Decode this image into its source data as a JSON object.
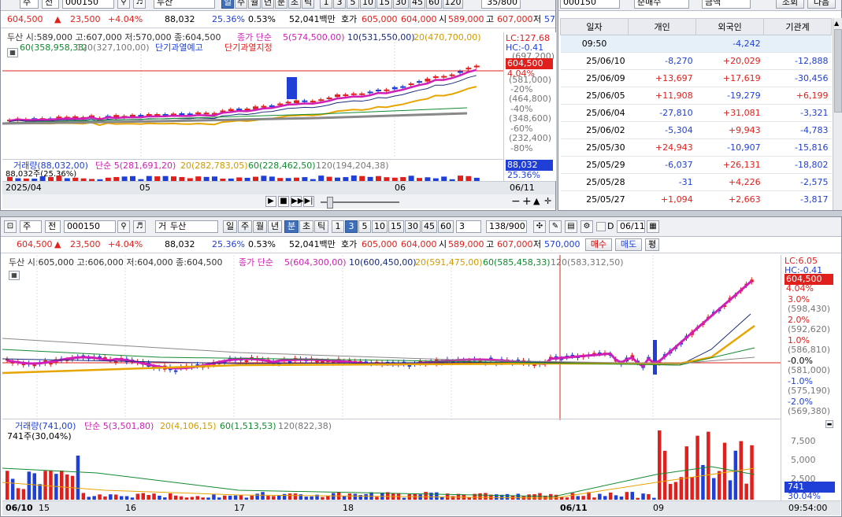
{
  "top_chart": {
    "toolbar": {
      "mode": "주",
      "prefix": "전",
      "code": "000150",
      "name": "두산",
      "period_buttons": [
        "일",
        "주",
        "월",
        "년",
        "분",
        "초",
        "틱"
      ],
      "active_period": "일",
      "minute_buttons": [
        "1",
        "3",
        "5",
        "10",
        "15",
        "30",
        "45",
        "60",
        "120"
      ],
      "count_value": "35/800"
    },
    "info": {
      "price": "604,500",
      "arrow": "▲",
      "change": "23,500",
      "change_pct": "+4.04%",
      "volume": "88,032",
      "turnover_pct": "25.36%",
      "pct2": "0.53%",
      "amount": "52,041백만",
      "bid_label": "호가",
      "ask": "605,000",
      "bid": "604,000",
      "open_label": "시",
      "open": "589,000",
      "high_label": "고",
      "high": "607,000",
      "low_label": "저",
      "low": "57"
    },
    "legend_line1": {
      "ohlc": "두산 시:589,000 고:607,000 저:570,000 종:604,500",
      "ma_label": "종가 단순",
      "ma5": "5(574,500,00)",
      "ma10": "10(531,550,00)",
      "ma20": "20(470,700,00)",
      "ma60": "60(358,958,33)",
      "ma120": "120(327,100,00)",
      "warn1": "단기과열예고",
      "warn2": "단기과열지정"
    },
    "right_axis": {
      "lc": "LC:127.68",
      "hc": "HC:-0.41",
      "top_price": "(697,200)",
      "current_price": "604,500",
      "current_pct": "4.04%",
      "ticks": [
        "(581,000)",
        "-20%",
        "(464,800)",
        "-40%",
        "(348,600)",
        "-60%",
        "(232,400)",
        "-80%"
      ]
    },
    "volume_legend": {
      "label": "거래량(88,032,00)",
      "ma5": "단순 5(281,691,20)",
      "ma20": "20(282,783,05)",
      "ma60": "60(228,462,50)",
      "ma120": "120(194,204,38)",
      "current": "88,032주(25.36%)"
    },
    "volume_axis": {
      "current": "88,032",
      "pct": "25.36%"
    },
    "x_labels": [
      "2025/04",
      "05",
      "06"
    ],
    "x_end": "06/11"
  },
  "investor_table": {
    "toolbar": {
      "code": "000150",
      "sell_buy": "순매수",
      "amount": "금액",
      "search": "조회",
      "next": "다음"
    },
    "headers": [
      "일자",
      "개인",
      "외국인",
      "기관계"
    ],
    "rows": [
      {
        "date": "09:50",
        "ind": "",
        "frn": "-4,242",
        "inst": ""
      },
      {
        "date": "25/06/10",
        "ind": "-8,270",
        "frn": "+20,029",
        "inst": "-12,888"
      },
      {
        "date": "25/06/09",
        "ind": "+13,697",
        "frn": "+17,619",
        "inst": "-30,456"
      },
      {
        "date": "25/06/05",
        "ind": "+11,908",
        "frn": "-19,279",
        "inst": "+6,199"
      },
      {
        "date": "25/06/04",
        "ind": "-27,810",
        "frn": "+31,081",
        "inst": "-3,321"
      },
      {
        "date": "25/06/02",
        "ind": "-5,304",
        "frn": "+9,943",
        "inst": "-4,783"
      },
      {
        "date": "25/05/30",
        "ind": "+24,943",
        "frn": "-10,907",
        "inst": "-15,816"
      },
      {
        "date": "25/05/29",
        "ind": "-6,037",
        "frn": "+26,131",
        "inst": "-18,802"
      },
      {
        "date": "25/05/28",
        "ind": "-31",
        "frn": "+4,226",
        "inst": "-2,575"
      },
      {
        "date": "25/05/27",
        "ind": "+1,094",
        "frn": "+2,663",
        "inst": "-3,817"
      }
    ],
    "colors": {
      "up": "#e0201c",
      "down": "#1f3fd6"
    }
  },
  "bottom_chart": {
    "toolbar": {
      "mode": "주",
      "prefix": "전",
      "code": "000150",
      "name_prefix": "거",
      "name": "두산",
      "period_buttons": [
        "일",
        "주",
        "월",
        "년"
      ],
      "minute_label": "분",
      "second_label": "초",
      "tick_label": "틱",
      "minute_buttons": [
        "1",
        "3",
        "5",
        "10",
        "15",
        "30",
        "45",
        "60"
      ],
      "active_minute": "3",
      "interval_value": "3",
      "count_value": "138/900",
      "date_value": "06/11",
      "d_label": "D"
    },
    "info": {
      "price": "604,500",
      "arrow": "▲",
      "change": "23,500",
      "change_pct": "+4.04%",
      "volume": "88,032",
      "turnover_pct": "25.36%",
      "pct2": "0.53%",
      "amount": "52,041백만",
      "bid_label": "호가",
      "ask": "605,000",
      "bid": "604,000",
      "open_label": "시",
      "open": "589,000",
      "high_label": "고",
      "high": "607,000",
      "low_label": "저",
      "low": "570,000",
      "buy": "매수",
      "sell": "매도",
      "avg": "평"
    },
    "legend_line1": {
      "ohlc": "두산 시:605,000 고:606,000 저:604,000 종:604,500",
      "ma_label": "종가 단순",
      "ma5": "5(604,300,00)",
      "ma10": "10(600,450,00)",
      "ma20": "20(591,475,00)",
      "ma60": "60(585,458,33)",
      "ma120": "120(583,312,50)"
    },
    "right_axis": {
      "lc": "LC:6.05",
      "hc": "HC:-0.41",
      "current_price": "604,500",
      "current_pct": "4.04%",
      "ticks": [
        "3.0%",
        "(598,430)",
        "2.0%",
        "(592,620)",
        "1.0%",
        "(586,810)",
        "-0.0%",
        "(581,000)",
        "-1.0%",
        "(575,190)",
        "-2.0%",
        "(569,380)"
      ]
    },
    "volume_legend": {
      "label": "거래량(741,00)",
      "ma5": "단순 5(3,501,80)",
      "ma20": "20(4,106,15)",
      "ma60": "60(1,513,53)",
      "ma120": "120(822,38)",
      "current": "741주(30,04%)"
    },
    "volume_axis": {
      "ticks": [
        "7,500",
        "5,000",
        "2,500"
      ],
      "current": "741",
      "pct": "30.04%"
    },
    "x_labels": [
      "06/10",
      "15",
      "16",
      "17",
      "18",
      "06/11",
      "09"
    ],
    "x_end": "09:54:00"
  }
}
